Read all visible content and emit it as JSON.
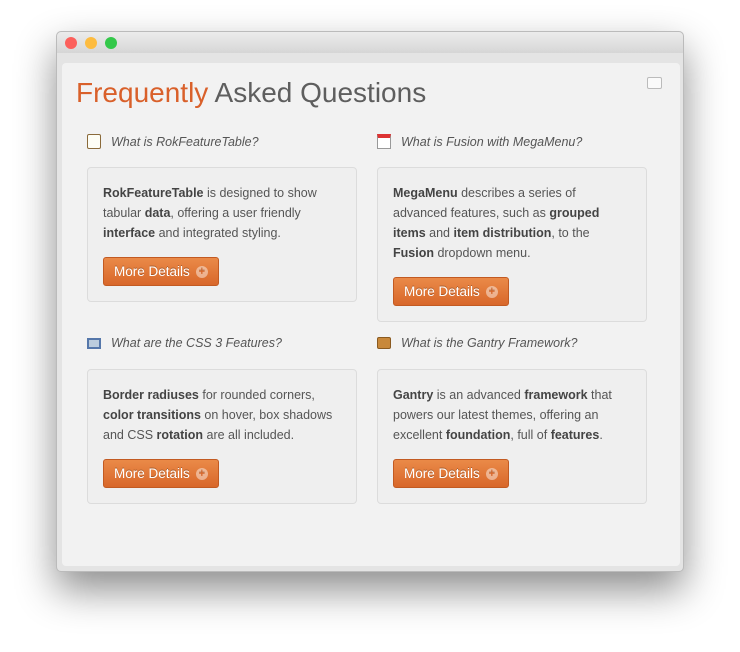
{
  "title": {
    "highlight": "Frequently",
    "rest": " Asked Questions"
  },
  "colors": {
    "accent": "#d9602a",
    "button": "#e07535"
  },
  "items": [
    {
      "question": "What is RokFeatureTable?",
      "icon": "clipboard-icon",
      "body": [
        {
          "t": "RokFeatureTable",
          "b": true
        },
        {
          "t": " is designed to show tabular "
        },
        {
          "t": "data",
          "b": true
        },
        {
          "t": ", offering a user friendly "
        },
        {
          "t": "interface",
          "b": true
        },
        {
          "t": " and integrated styling."
        }
      ],
      "button": "More Details"
    },
    {
      "question": "What is Fusion with MegaMenu?",
      "icon": "calendar-icon",
      "body": [
        {
          "t": "MegaMenu",
          "b": true
        },
        {
          "t": " describes a series of advanced features, such as "
        },
        {
          "t": "grouped items",
          "b": true
        },
        {
          "t": " and "
        },
        {
          "t": "item distribution",
          "b": true
        },
        {
          "t": ", to the "
        },
        {
          "t": "Fusion",
          "b": true
        },
        {
          "t": " dropdown menu."
        }
      ],
      "button": "More Details"
    },
    {
      "question": "What are the CSS 3 Features?",
      "icon": "monitor-icon",
      "body": [
        {
          "t": "Border radiuses",
          "b": true
        },
        {
          "t": " for rounded corners, "
        },
        {
          "t": "color transitions",
          "b": true
        },
        {
          "t": " on hover, box shadows and CSS "
        },
        {
          "t": "rotation",
          "b": true
        },
        {
          "t": " are all included."
        }
      ],
      "button": "More Details"
    },
    {
      "question": "What is the Gantry Framework?",
      "icon": "briefcase-icon",
      "body": [
        {
          "t": "Gantry",
          "b": true
        },
        {
          "t": " is an advanced "
        },
        {
          "t": "framework",
          "b": true
        },
        {
          "t": " that powers our latest themes, offering an excellent "
        },
        {
          "t": "foundation",
          "b": true
        },
        {
          "t": ", full of "
        },
        {
          "t": "features",
          "b": true
        },
        {
          "t": "."
        }
      ],
      "button": "More Details"
    }
  ]
}
